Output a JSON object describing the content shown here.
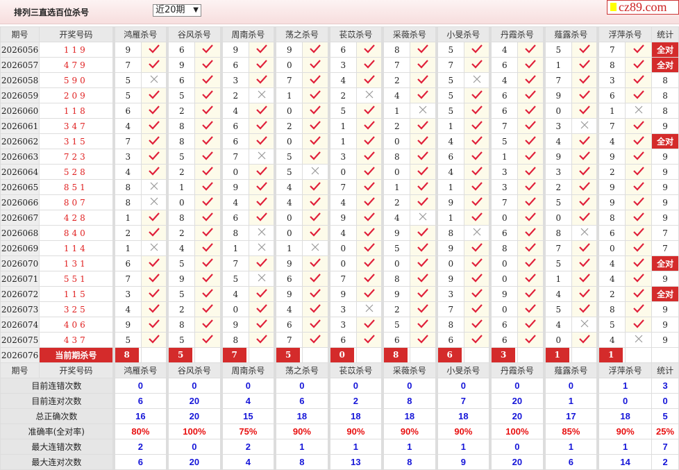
{
  "header": {
    "title": "排列三直选百位杀号",
    "range_select": "近20期",
    "logo": "cz89.com"
  },
  "columns": {
    "period": "期号",
    "draw": "开奖号码",
    "experts": [
      "鸿雁杀号",
      "谷风杀号",
      "周南杀号",
      "荡之杀号",
      "苌苡杀号",
      "采薇杀号",
      "小旻杀号",
      "丹霞杀号",
      "薤露杀号",
      "浮萍杀号"
    ],
    "stat": "统计"
  },
  "rows": [
    {
      "period": "2026056",
      "draw": "119",
      "kills": [
        9,
        6,
        9,
        9,
        6,
        8,
        5,
        4,
        5,
        7
      ],
      "hits": "1111111111",
      "stat": "全对"
    },
    {
      "period": "2026057",
      "draw": "479",
      "kills": [
        7,
        9,
        6,
        0,
        3,
        7,
        7,
        6,
        1,
        8
      ],
      "hits": "1111111111",
      "stat": "全对"
    },
    {
      "period": "2026058",
      "draw": "590",
      "kills": [
        5,
        6,
        3,
        7,
        4,
        2,
        5,
        4,
        7,
        3
      ],
      "hits": "0111110111",
      "stat": "8"
    },
    {
      "period": "2026059",
      "draw": "209",
      "kills": [
        5,
        5,
        2,
        1,
        2,
        4,
        5,
        6,
        9,
        6
      ],
      "hits": "1101011111",
      "stat": "8"
    },
    {
      "period": "2026060",
      "draw": "118",
      "kills": [
        6,
        2,
        4,
        0,
        5,
        1,
        5,
        6,
        0,
        1
      ],
      "hits": "1111101110",
      "stat": "8"
    },
    {
      "period": "2026061",
      "draw": "347",
      "kills": [
        4,
        8,
        6,
        2,
        1,
        2,
        1,
        7,
        3,
        7
      ],
      "hits": "1111111101",
      "stat": "9"
    },
    {
      "period": "2026062",
      "draw": "315",
      "kills": [
        7,
        8,
        6,
        0,
        1,
        0,
        4,
        5,
        4,
        4
      ],
      "hits": "1111111111",
      "stat": "全对"
    },
    {
      "period": "2026063",
      "draw": "723",
      "kills": [
        3,
        5,
        7,
        5,
        3,
        8,
        6,
        1,
        9,
        9
      ],
      "hits": "1101111111",
      "stat": "9"
    },
    {
      "period": "2026064",
      "draw": "528",
      "kills": [
        4,
        2,
        0,
        5,
        0,
        0,
        4,
        3,
        3,
        2
      ],
      "hits": "1110111111",
      "stat": "9"
    },
    {
      "period": "2026065",
      "draw": "851",
      "kills": [
        8,
        1,
        9,
        4,
        7,
        1,
        1,
        3,
        2,
        9
      ],
      "hits": "0111111111",
      "stat": "9"
    },
    {
      "period": "2026066",
      "draw": "807",
      "kills": [
        8,
        0,
        4,
        4,
        4,
        2,
        9,
        7,
        5,
        9
      ],
      "hits": "0111111111",
      "stat": "9"
    },
    {
      "period": "2026067",
      "draw": "428",
      "kills": [
        1,
        8,
        6,
        0,
        9,
        4,
        1,
        0,
        0,
        8
      ],
      "hits": "1111101111",
      "stat": "9"
    },
    {
      "period": "2026068",
      "draw": "840",
      "kills": [
        2,
        2,
        8,
        0,
        4,
        9,
        8,
        6,
        8,
        6
      ],
      "hits": "1101110101",
      "stat": "7"
    },
    {
      "period": "2026069",
      "draw": "114",
      "kills": [
        1,
        4,
        1,
        1,
        0,
        5,
        9,
        8,
        7,
        0
      ],
      "hits": "0100111111",
      "stat": "7"
    },
    {
      "period": "2026070",
      "draw": "131",
      "kills": [
        6,
        5,
        7,
        9,
        0,
        0,
        0,
        0,
        5,
        4
      ],
      "hits": "1111111111",
      "stat": "全对"
    },
    {
      "period": "2026071",
      "draw": "551",
      "kills": [
        7,
        9,
        5,
        6,
        7,
        8,
        9,
        0,
        1,
        4
      ],
      "hits": "1101111111",
      "stat": "9"
    },
    {
      "period": "2026072",
      "draw": "115",
      "kills": [
        3,
        5,
        4,
        9,
        9,
        9,
        3,
        9,
        4,
        2
      ],
      "hits": "1111111111",
      "stat": "全对"
    },
    {
      "period": "2026073",
      "draw": "325",
      "kills": [
        4,
        2,
        0,
        4,
        3,
        2,
        7,
        0,
        5,
        8
      ],
      "hits": "1111011111",
      "stat": "9"
    },
    {
      "period": "2026074",
      "draw": "406",
      "kills": [
        9,
        8,
        9,
        6,
        3,
        5,
        8,
        6,
        4,
        5
      ],
      "hits": "1111111101",
      "stat": "9"
    },
    {
      "period": "2026075",
      "draw": "437",
      "kills": [
        5,
        5,
        8,
        7,
        6,
        6,
        6,
        6,
        0,
        4
      ],
      "hits": "1111111110",
      "stat": "9"
    }
  ],
  "current": {
    "period": "2026076",
    "label": "当前期杀号",
    "kills": [
      8,
      5,
      7,
      5,
      0,
      8,
      6,
      3,
      1,
      1
    ]
  },
  "stats": [
    {
      "label": "目前连错次数",
      "values": [
        "0",
        "0",
        "0",
        "0",
        "0",
        "0",
        "0",
        "0",
        "0",
        "1",
        "3"
      ]
    },
    {
      "label": "目前连对次数",
      "values": [
        "6",
        "20",
        "4",
        "6",
        "2",
        "8",
        "7",
        "20",
        "1",
        "0",
        "0"
      ]
    },
    {
      "label": "总正确次数",
      "values": [
        "16",
        "20",
        "15",
        "18",
        "18",
        "18",
        "18",
        "20",
        "17",
        "18",
        "5"
      ]
    },
    {
      "label": "准确率(全对率)",
      "values": [
        "80%",
        "100%",
        "75%",
        "90%",
        "90%",
        "90%",
        "90%",
        "100%",
        "85%",
        "90%",
        "25%"
      ],
      "red": true
    },
    {
      "label": "最大连错次数",
      "values": [
        "2",
        "0",
        "2",
        "1",
        "1",
        "1",
        "1",
        "0",
        "1",
        "1",
        "7"
      ]
    },
    {
      "label": "最大连对次数",
      "values": [
        "6",
        "20",
        "4",
        "8",
        "13",
        "8",
        "9",
        "20",
        "6",
        "14",
        "2"
      ]
    }
  ],
  "colors": {
    "accent": "#d42b2b",
    "hit": "#e0203a",
    "miss": "#999999",
    "stat_value": "#1515d8"
  }
}
